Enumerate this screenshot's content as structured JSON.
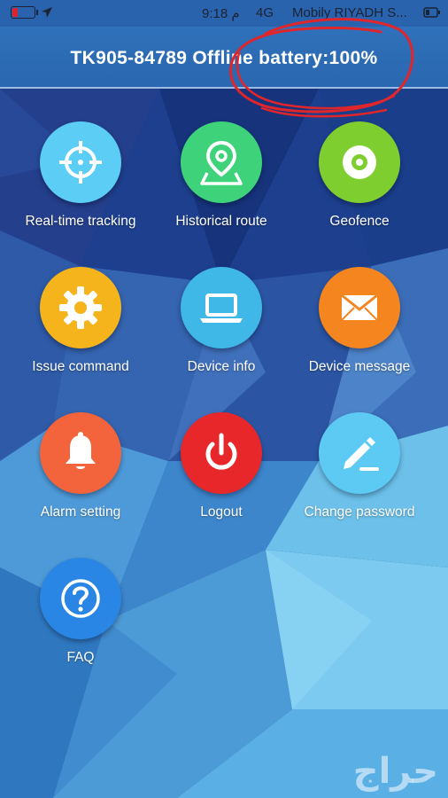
{
  "status_bar": {
    "time": "9:18 م",
    "network": "4G",
    "carrier": "Mobily RIYADH S...",
    "battery_level_fraction": 0.22
  },
  "header": {
    "title": "TK905-84789 Offline battery:100%"
  },
  "colors": {
    "header": "#2a67b0",
    "real_time_tracking": "#5ccef6",
    "historical_route": "#3ed27a",
    "geofence": "#7fce30",
    "issue_command": "#f5b41b",
    "device_info": "#3fb8e8",
    "device_message": "#f5851f",
    "alarm_setting": "#f3643c",
    "logout": "#e8272b",
    "change_password": "#5ccaf3",
    "faq": "#2a86e4",
    "annotation": "#e0262b"
  },
  "menu": {
    "items": [
      {
        "label": "Real-time tracking",
        "icon": "crosshair-icon"
      },
      {
        "label": "Historical route",
        "icon": "map-pin-icon"
      },
      {
        "label": "Geofence",
        "icon": "target-icon"
      },
      {
        "label": "Issue command",
        "icon": "gear-icon"
      },
      {
        "label": "Device info",
        "icon": "laptop-icon"
      },
      {
        "label": "Device message",
        "icon": "envelope-icon"
      },
      {
        "label": "Alarm setting",
        "icon": "bell-icon"
      },
      {
        "label": "Logout",
        "icon": "power-icon"
      },
      {
        "label": "Change password",
        "icon": "pencil-icon"
      },
      {
        "label": "FAQ",
        "icon": "question-icon"
      }
    ]
  },
  "watermark": {
    "text": "حراج"
  }
}
